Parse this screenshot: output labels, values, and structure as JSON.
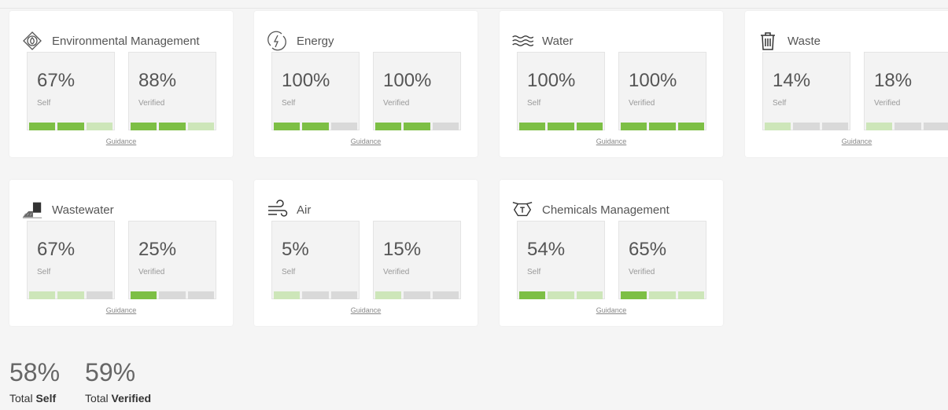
{
  "cards": [
    {
      "title": "Environmental Management",
      "icon": "environmental-management-icon",
      "self": {
        "value": "67%",
        "label": "Self",
        "segments": [
          "full",
          "full",
          "light"
        ]
      },
      "verified": {
        "value": "88%",
        "label": "Verified",
        "segments": [
          "full",
          "full",
          "light"
        ]
      },
      "guidance": "Guidance"
    },
    {
      "title": "Energy",
      "icon": "energy-icon",
      "self": {
        "value": "100%",
        "label": "Self",
        "segments": [
          "full",
          "full",
          "empty"
        ]
      },
      "verified": {
        "value": "100%",
        "label": "Verified",
        "segments": [
          "full",
          "full",
          "empty"
        ]
      },
      "guidance": "Guidance"
    },
    {
      "title": "Water",
      "icon": "water-icon",
      "self": {
        "value": "100%",
        "label": "Self",
        "segments": [
          "full",
          "full",
          "full"
        ]
      },
      "verified": {
        "value": "100%",
        "label": "Verified",
        "segments": [
          "full",
          "full",
          "full"
        ]
      },
      "guidance": "Guidance"
    },
    {
      "title": "Waste",
      "icon": "trash-icon",
      "self": {
        "value": "14%",
        "label": "Self",
        "segments": [
          "light",
          "empty",
          "empty"
        ]
      },
      "verified": {
        "value": "18%",
        "label": "Verified",
        "segments": [
          "light",
          "empty",
          "empty"
        ]
      },
      "guidance": "Guidance"
    },
    {
      "title": "Wastewater",
      "icon": "wastewater-icon",
      "self": {
        "value": "67%",
        "label": "Self",
        "segments": [
          "light",
          "light",
          "empty"
        ]
      },
      "verified": {
        "value": "25%",
        "label": "Verified",
        "segments": [
          "full",
          "empty",
          "empty"
        ]
      },
      "guidance": "Guidance"
    },
    {
      "title": "Air",
      "icon": "wind-icon",
      "self": {
        "value": "5%",
        "label": "Self",
        "segments": [
          "light",
          "empty",
          "empty"
        ]
      },
      "verified": {
        "value": "15%",
        "label": "Verified",
        "segments": [
          "light",
          "empty",
          "empty"
        ]
      },
      "guidance": "Guidance"
    },
    {
      "title": "Chemicals Management",
      "icon": "chemicals-icon",
      "self": {
        "value": "54%",
        "label": "Self",
        "segments": [
          "full",
          "light",
          "light"
        ]
      },
      "verified": {
        "value": "65%",
        "label": "Verified",
        "segments": [
          "full",
          "light",
          "light"
        ]
      },
      "guidance": "Guidance"
    }
  ],
  "totals": {
    "self": {
      "value": "58%",
      "prefix": "Total",
      "label": "Self"
    },
    "verified": {
      "value": "59%",
      "prefix": "Total",
      "label": "Verified"
    }
  },
  "colors": {
    "full": "#7dbf45",
    "light": "#cde6b9",
    "empty": "#d9d9d9"
  }
}
